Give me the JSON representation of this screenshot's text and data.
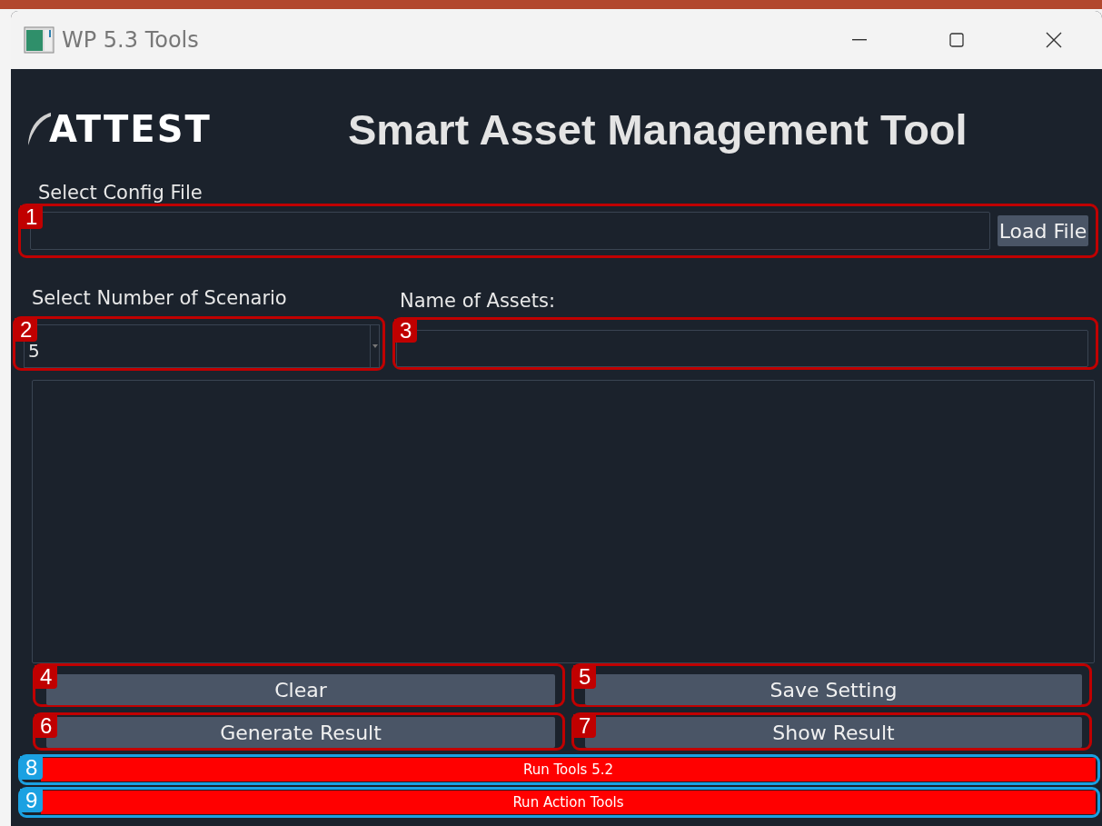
{
  "window": {
    "title": "WP 5.3 Tools"
  },
  "header": {
    "logo": "ATTEST",
    "title": "Smart Asset Management Tool"
  },
  "config": {
    "label": "Select Config File",
    "button": "Load File",
    "callout": {
      "number": "1",
      "color": "#c00000"
    }
  },
  "scenario": {
    "label": "Select Number of Scenario",
    "value": "5",
    "callout": {
      "number": "2",
      "color": "#c00000"
    }
  },
  "assets": {
    "label": "Name of Assets:",
    "callout": {
      "number": "3",
      "color": "#c00000"
    }
  },
  "buttons": [
    {
      "label": "Clear",
      "callout": {
        "number": "4",
        "color": "#c00000"
      }
    },
    {
      "label": "Save Setting",
      "callout": {
        "number": "5",
        "color": "#c00000"
      }
    },
    {
      "label": "Generate Result",
      "callout": {
        "number": "6",
        "color": "#c00000"
      }
    },
    {
      "label": "Show Result",
      "callout": {
        "number": "7",
        "color": "#c00000"
      }
    }
  ],
  "run_buttons": [
    {
      "label": "Run Tools 5.2",
      "callout": {
        "number": "8",
        "color": "#1ba1e2"
      }
    },
    {
      "label": "Run Action Tools",
      "callout": {
        "number": "9",
        "color": "#1ba1e2"
      }
    }
  ]
}
